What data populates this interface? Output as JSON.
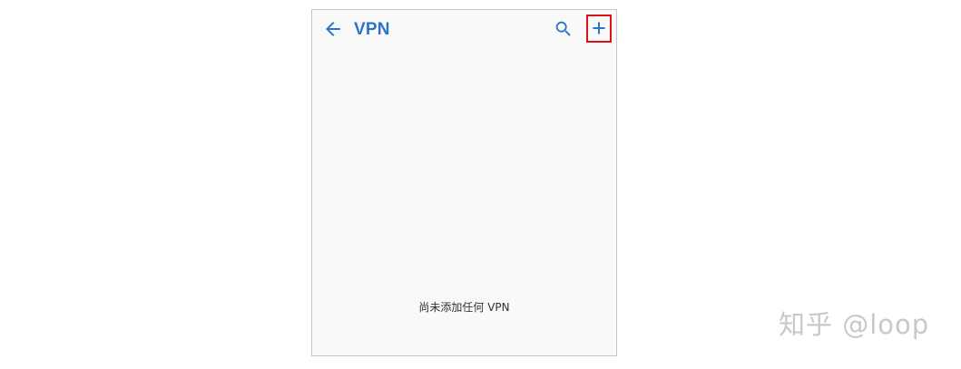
{
  "appbar": {
    "title": "VPN",
    "back_icon": "arrow-left-icon",
    "search_icon": "search-icon",
    "add_icon": "plus-icon"
  },
  "main": {
    "empty_message": "尚未添加任何 VPN"
  },
  "watermark": {
    "text": "知乎 @loop"
  },
  "colors": {
    "accent": "#2b74c9",
    "highlight_box": "#e01018",
    "screen_background": "#f9f9f9",
    "empty_text": "#333333",
    "watermark": "#c8c8c8"
  }
}
